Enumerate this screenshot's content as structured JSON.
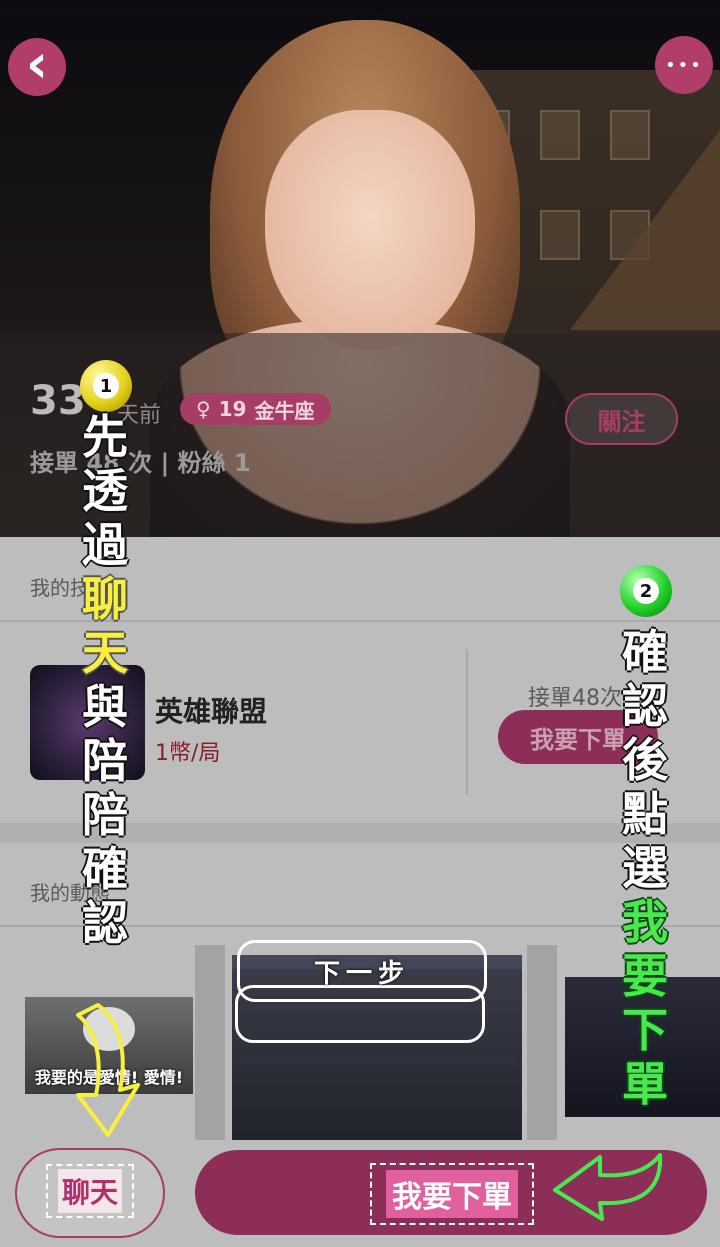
{
  "profile": {
    "back_icon": "chevron-left-icon",
    "more_icon": "more-dots-icon",
    "more_glyph": "•••",
    "back_glyph": "‹",
    "user_number": "33",
    "last_active": "天前",
    "tag": {
      "gender_symbol": "♀",
      "age": "19",
      "zodiac": "金牛座"
    },
    "stats": "接單 48 次 | 粉絲 1",
    "follow_label": "關注"
  },
  "skills": {
    "section_title": "我的技能",
    "item": {
      "name": "英雄聯盟",
      "price": "1幣/局",
      "accepted": "接單48次",
      "order_label": "我要下單"
    }
  },
  "moments": {
    "section_title": "我的動態",
    "caption": "我要的是愛情! 愛情!"
  },
  "bottom_bar": {
    "chat_label": "聊天",
    "order_label": "我要下單"
  },
  "annotations": {
    "step1_number": "1",
    "step2_number": "2",
    "next_step": "下一步",
    "left_white_1": [
      "先",
      "透",
      "過"
    ],
    "left_yellow": [
      "聊",
      "天",
      "與"
    ],
    "left_white_2": [
      "陪",
      "陪",
      "確",
      "認"
    ],
    "right_white": [
      "確",
      "認",
      "後",
      "點",
      "選"
    ],
    "right_green": [
      "我",
      "要",
      "下",
      "單"
    ]
  },
  "colors": {
    "brand": "#a63d67",
    "brand_dark": "#8c2e57",
    "highlight_yellow": "#f7f040",
    "highlight_green": "#49e84f"
  }
}
